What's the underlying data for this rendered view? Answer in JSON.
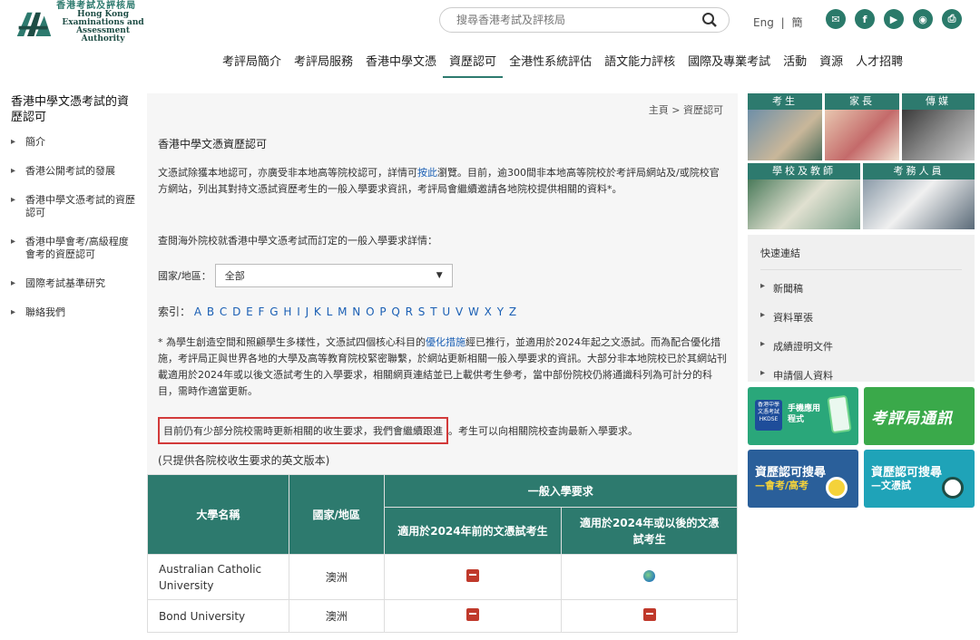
{
  "header": {
    "logo_zh": "香港考試及評核局",
    "logo_en_lines": [
      "Hong Kong",
      "Examinations and",
      "Assessment Authority"
    ],
    "search_placeholder": "搜尋香港考試及評核局",
    "lang_en": "Eng",
    "lang_sep": "|",
    "lang_sc": "簡",
    "social_icons": [
      "email-icon",
      "facebook-icon",
      "youtube-icon",
      "rss-icon",
      "print-icon"
    ]
  },
  "nav": {
    "items": [
      "考評局簡介",
      "考評局服務",
      "香港中學文憑",
      "資歷認可",
      "全港性系統評估",
      "語文能力評核",
      "國際及專業考試",
      "活動",
      "資源",
      "人才招聘"
    ],
    "active_index": 3
  },
  "sidebar": {
    "title": "香港中學文憑考試的資歷認可",
    "items": [
      "簡介",
      "香港公開考試的發展",
      "香港中學文憑考試的資歷認可",
      "香港中學會考/高級程度會考的資歷認可",
      "國際考試基準研究",
      "聯絡我們"
    ]
  },
  "main": {
    "breadcrumb": "主頁 > 資歷認可",
    "heading": "香港中學文憑資歷認可",
    "p1_a": "文憑試除獲本地認可，亦廣受非本地高等院校認可，詳情可",
    "p1_link": "按此",
    "p1_b": "瀏覽。目前，逾300間非本地高等院校於考評局網站及/或院校官方網站，列出其對持文憑試資歷考生的一般入學要求資訊，考評局會繼續邀請各地院校提供相關的資料*。",
    "p2": "查閱海外院校就香港中學文憑考試而訂定的一般入學要求詳情：",
    "region_label": "國家/地區：",
    "region_value": "全部",
    "index_label": "索引：",
    "index_letters": "A B C D E F G H I J K L M N O P Q R S T U V W X Y Z",
    "p3_a": "* 為學生創造空間和照顧學生多樣性，文憑試四個核心科目的",
    "p3_link": "優化措施",
    "p3_b": "經已推行，並適用於2024年起之文憑試。而為配合優化措施，考評局正與世界各地的大學及高等教育院校緊密聯繫，於網站更新相關一般入學要求的資訊。大部分非本地院校已於其網站刊載適用於2024年或以後文憑試考生的入學要求，相關網頁連結並已上載供考生參考，當中部份院校仍將通識科列為可計分的科目，需時作適當更新。",
    "note_boxed": "目前仍有少部分院校需時更新相關的收生要求，我們會繼續跟進",
    "note_rest": "。考生可以向相關院校查詢最新入學要求。",
    "p4": "(只提供各院校收生要求的英文版本)"
  },
  "table": {
    "h_uni": "大學名稱",
    "h_region": "國家/地區",
    "h_general": "一般入學要求",
    "h_before": "適用於2024年前的文憑試考生",
    "h_after": "適用於2024年或以後的文憑試考生",
    "rows": [
      {
        "name": "Australian Catholic University",
        "region": "澳洲",
        "before": "pdf-icon",
        "after": "globe-icon"
      },
      {
        "name": "Bond University",
        "region": "澳洲",
        "before": "pdf-icon",
        "after": "pdf-icon"
      }
    ]
  },
  "right": {
    "tiles": [
      "考生",
      "家長",
      "傳媒",
      "學校及教師",
      "考務人員"
    ],
    "quick_title": "快速連結",
    "quick_links": [
      "新聞稿",
      "資料單張",
      "成績證明文件",
      "申請個人資料"
    ],
    "banner1_a": "香港中學文憑考試 HKDSE",
    "banner1_b": "手機應用程式",
    "banner2": "考評局通訊",
    "banner3_a": "資歷認可搜尋",
    "banner3_b": "—會考/高考",
    "banner4_a": "資歷認可搜尋",
    "banner4_b": "—文憑試"
  },
  "colors": {
    "brand": "#2d7a6e",
    "link": "#1a5fb4",
    "highlight": "#d23a3a"
  }
}
